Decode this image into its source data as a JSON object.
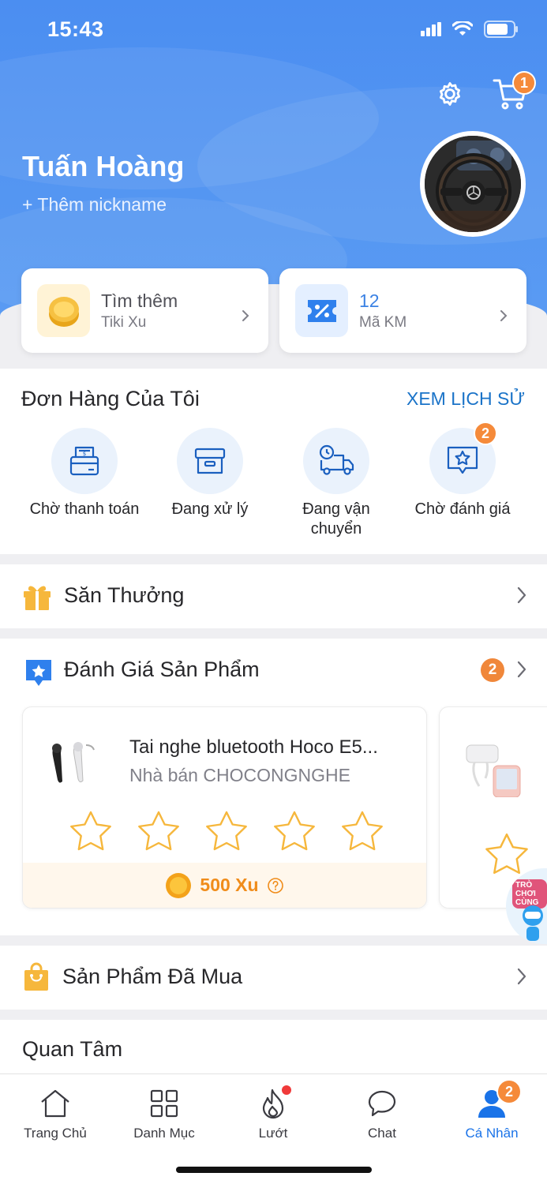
{
  "status_bar": {
    "time": "15:43"
  },
  "header": {
    "cart_count": "1",
    "user_name": "Tuấn Hoàng",
    "add_nickname": "+ Thêm nickname"
  },
  "cards": [
    {
      "title": "Tìm thêm",
      "subtitle": "Tiki Xu"
    },
    {
      "title": "12",
      "subtitle": "Mã KM"
    }
  ],
  "orders": {
    "title": "Đơn Hàng Của Tôi",
    "history_link": "XEM LỊCH SỬ",
    "items": [
      {
        "label": "Chờ thanh toán",
        "icon": "payment-terminal-icon"
      },
      {
        "label": "Đang xử lý",
        "icon": "box-icon"
      },
      {
        "label": "Đang vận chuyển",
        "icon": "delivery-truck-icon"
      },
      {
        "label": "Chờ đánh giá",
        "icon": "star-chat-icon",
        "badge": "2"
      }
    ]
  },
  "reward": {
    "title": "Săn Thưởng"
  },
  "review": {
    "title": "Đánh Giá Sản Phẩm",
    "badge": "2",
    "product_name": "Tai nghe bluetooth Hoco E5...",
    "seller": "Nhà bán CHOCONGNGHE",
    "reward": "500 Xu",
    "float_text": "TRÒ CHƠI CÙNG"
  },
  "purchased": {
    "title": "Sản Phẩm Đã Mua"
  },
  "interest": {
    "title": "Quan Tâm"
  },
  "nav": {
    "items": [
      {
        "label": "Trang Chủ",
        "icon": "home-icon"
      },
      {
        "label": "Danh Mục",
        "icon": "grid-icon"
      },
      {
        "label": "Lướt",
        "icon": "flame-icon"
      },
      {
        "label": "Chat",
        "icon": "chat-bubble-icon"
      },
      {
        "label": "Cá Nhân",
        "icon": "user-icon",
        "badge": "2"
      }
    ]
  },
  "colors": {
    "brand_blue": "#4b8ef1",
    "accent_orange": "#f58a3a",
    "active_nav": "#1a73e8"
  }
}
